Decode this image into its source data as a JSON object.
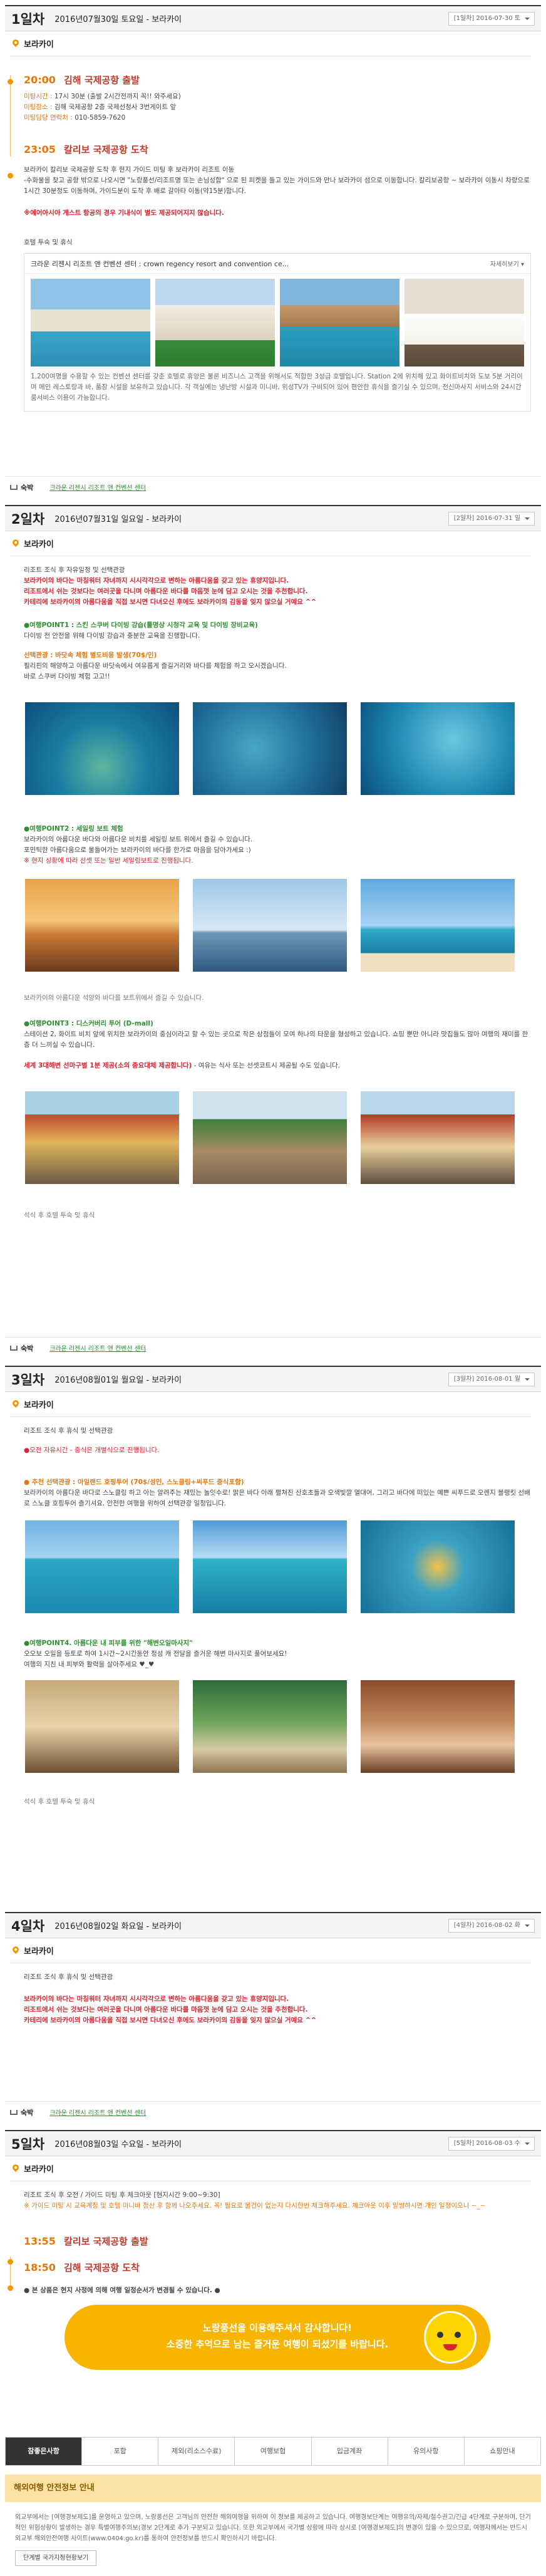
{
  "days": [
    {
      "label": "1일차",
      "date": "2016년07월30일 토요일 - 보라카이",
      "select": "[1일차] 2016-07-30 토",
      "location": "보라카이",
      "events": [
        {
          "time": "20:00",
          "title": "김해 국제공항 출발"
        },
        {
          "time": "23:05",
          "title": "칼리보 국제공항 도착"
        }
      ],
      "meet": [
        {
          "k": "미팅시간 :",
          "v": "17시 30분 (출발 2시간전까지 꼭!! 와주세요)"
        },
        {
          "k": "미팅장소 :",
          "v": "김해 국제공항 2층 국제선청사 3번게이트 앞"
        },
        {
          "k": "미팅담당 연락처 :",
          "v": "010-5859-7620"
        }
      ],
      "arrive_text": "보라카이 칼리보 국제공항 도착 후 현지 가이드 미팅 후 보라카이 리조트 이동",
      "arrive_text2": "-수화물을 찾고 공항 밖으로 나오시면 \"노랑풍선/리조트명 또는 손님성함\" 으로 된 피켓을 들고 있는 가이드와 만나 보라카이 섬으로 이동합니다. 칼리보공항 ~ 보라카이 이동시 차량으로 1시간 30분정도 이동하며, 가이드분이 도착 후 배로 갈아타 이동(약15분)합니다.",
      "notice": "※에어아시아 게스트 항공의 경우 기내식이 별도 제공되어지지 않습니다.",
      "hotel_note": "호텔 투숙 및 휴식",
      "hotel_name": "크라운 리젠시 리조트 앤 컨벤션 센터 : crown regency resort and convention ce...",
      "hotel_more": "자세히보기 ▾",
      "hotel_desc": "1,200여명을 수용할 수 있는 컨벤션 센터를 갖춘 호텔로 휴양은 물론 비즈니스 고객을 위해서도 적합한 3성급 호텔입니다. Station 2에 위치해 있고 화이트비치와 도보 5분 거리이며 메인 레스토랑과 바, 풀장 시설을 보유하고 있습니다. 각 객실에는 냉난방 시설과 미니바, 위성TV가 구비되어 있어 편안한 휴식을 즐기실 수 있으며, 전신마사지 서비스와 24시간 룸서비스 이용이 가능합니다.",
      "stay_label": "숙박",
      "stay_link": "크라운 리젠시 리조트 앤 컨벤션 센터"
    },
    {
      "label": "2일차",
      "date": "2016년07월31일 일요일 - 보라카이",
      "select": "[2일차] 2016-07-31 일",
      "location": "보라카이",
      "lines": [
        "리조트 조식 후 자유일정 및 선택관광",
        "보라카이의 바다는 마칭워터 자녀까지 시시각각으로 변하는 아름다움을 갖고 있는 휴양지입니다.",
        "리조트에서 쉬는 것보다는 여러곳을 다니며 아름다운 바다를 마음껏 눈에 담고 오시는 것을 추천합니다.",
        "카테리에 보라카이의 아름다움을 직접 보시면 다녀오신 후에도 보라카이의 감동을 잊지 않으실 거예요 ^^"
      ],
      "p1_title": "●여행POINT1 : 스킨 스쿠버 다이빙 강습(툴명상 시청각 교육 및 다이빙 장비교육)",
      "p1_text": "다이빙 전 안전을 위해 다이빙 강습과 충분한 교육을 진행합니다.",
      "p1_opt": "선택관광 : 바닷속 체험 별도비용 발생(70$/인)",
      "p1_text2": "필리핀의 해양하고 아름다운 바닷속에서 여유롭게 즐길거리와 바다를 체험을 하고 오시겠습니다.",
      "p1_text3": "바로 스쿠버 다이빙 체험 고고!!",
      "p2_title": "●여행POINT2 : 세일링 보트 체험",
      "p2_text": "보라카이의 아름다운 바다와 아름다운 비치를 세일링 보트 위에서 즐길 수 있습니다.",
      "p2_text2": "포민틱한 아름다움으로 물들어가는 보라카이의 바다를 한가로 마음을 담아가세요 :)",
      "p2_note": "※ 현지 상황에 따라 선셋 또는 일반 세일링보트로 진행됩니다.",
      "p2_cap": "보라카이의 아름다운 석양와 바다를 보트위에서 즐길 수 있습니다.",
      "p3_title": "●여행POINT3 : 디스커버리 투어 (D-mall)",
      "p3_text": "스테이션 2, 화이트 비치 앞에 위치한 보라카이의 중심이라고 할 수 있는 곳으로 작은 상점들이 모여 하나의 타운을 형성하고 있습니다. 쇼핑 뿐만 아니라 맛집들도 많아 여행의 재미를 한층 더 느끼실 수 있습니다.",
      "p3_red": "세계 3대해변 선마구별 1분 제공(소의 중요대체 제공합니다)",
      "p3_red2": " - 여유는 식사 또는 선셋코트시 제공될 수도 있습니다.",
      "end_note": "석식 후 호텔 투숙 및 휴식",
      "stay_label": "숙박",
      "stay_link": "크라운 리젠시 리조트 앤 컨벤션 센터"
    },
    {
      "label": "3일차",
      "date": "2016년08월01일 월요일 - 보라카이",
      "select": "[3일차] 2016-08-01 월",
      "location": "보라카이",
      "lines": [
        "리조트 조식 후 휴식 및 선택관광",
        "●오전 자유시간 - 중식은 개별식으로 진행됩니다."
      ],
      "p1_title": "● 추천 선택관광 : 아일랜드 호핑투어 (70$/성인, 스노클링+씨푸드 중식포함)",
      "p1_text": "보라카이의 아름다운 바다로 스노클링 하고 아는 알려주는 재밌는 놀잇수로! 맑은 바다 아래 펼쳐진 산호초들과 오색빛깔 열대어, 그리고 바다에 떠있는 예쁜 씨푸드로 오렌지 블랭킷 선배로 스노클 호핑투어 즐기셔요. 안전한 여행을 위하여 선택관광 일정입니다.",
      "p2_title": "●여행POINT4. 아름다운 내 피부를 위한 \"해변오일마사지\"",
      "p2_text": "오오보 오일을 등토로 하여 1시간~2시간동안 정성 캐 전달을 즐거운 해변 마사지로 풀어보세요!",
      "p2_text2": "여행의 지친 내 피부와 활력을 살아주세요 ♥_♥",
      "end_note": "석식 후 호텔 투숙 및 휴식"
    },
    {
      "label": "4일차",
      "date": "2016년08월02일 화요일 - 보라카이",
      "select": "[4일차] 2016-08-02 화",
      "location": "보라카이",
      "lines": [
        "리조트 조식 후 휴식 및 선택관광",
        "보라카이의 바다는 마칭워터 자녀까지 시시각각으로 변하는 아름다움을 갖고 있는 휴양지입니다.",
        "리조트에서 쉬는 것보다는 여러곳을 다니며 아름다운 바다를 마음껏 눈에 담고 오시는 것을 추천합니다.",
        "카테리에 보라카이의 아름다움을 직접 보시면 다녀오신 후에도 보라카이의 감동을 잊지 않으실 거예요 ^^"
      ],
      "stay_label": "숙박",
      "stay_link": "크라운 리젠시 리조트 앤 컨벤션 센터"
    },
    {
      "label": "5일차",
      "date": "2016년08월03일 수요일 - 보라카이",
      "select": "[5일차] 2016-08-03 수",
      "location": "보라카이",
      "lines": [
        "리조트 조식 후 오전 / 가이드 미팅 후 체크아웃 [현지시간 9:00~9:30]",
        "※ 가이드 미팅 시 교육계정 및 호텔 미니바 정산 후 함께 나오주세요. 꼭! 필요로 물건이 없는지 다시한번 체크해주세요. 체크아웃 이후 말썽하시면 개인 일정이오니 ~_~"
      ],
      "events": [
        {
          "time": "13:55",
          "title": "칼리보 국제공항 출발"
        },
        {
          "time": "18:50",
          "title": "김해 국제공항 도착"
        }
      ],
      "end_note": "● 본 상품은 현지 사정에 의해 여행 일정순서가 변경될 수 있습니다. ●",
      "banner1": "노랑풍선을 이용해주셔서 감사합니다!",
      "banner2": "소중한 추억으로 남는 즐거운 여행이 되셨기를 바랍니다."
    }
  ],
  "tabs": [
    "참좋은사항",
    "포함",
    "제외(리소스수료)",
    "여행보험",
    "입금계좌",
    "유의사항",
    "쇼핑안내"
  ],
  "guide": {
    "title": "해외여행 안전정보 안내",
    "text": "외교부에서는 [여행경보제도]를 운영하고 있으며, 노랑풍선은 고객님의 안전한 해외여행을 위하여 이 정보를 제공하고 있습니다. 여행경보단계는 여행유의/자제/철수권고/긴급 4단계로 구분하며, 단기적인 위험상황이 발생하는 경우 특별여행주의보(경보 2단계로 추가 구분되고 있습니다. 또한 외교부에서 국가별 상황에 따라 상시로 [여행경보제도]의 변경이 있을 수 있으므로, 여행자께서는 반드시 외교부 해외안전여행 사이트(www.0404.go.kr)를 통하여 안전정보를 반드시 확인하시기 바랍니다.",
    "button": "단계별 국가지정현황보기"
  },
  "colors": {
    "accent": "#f39800",
    "green": "#2f8f2f",
    "red": "#d9232d"
  }
}
